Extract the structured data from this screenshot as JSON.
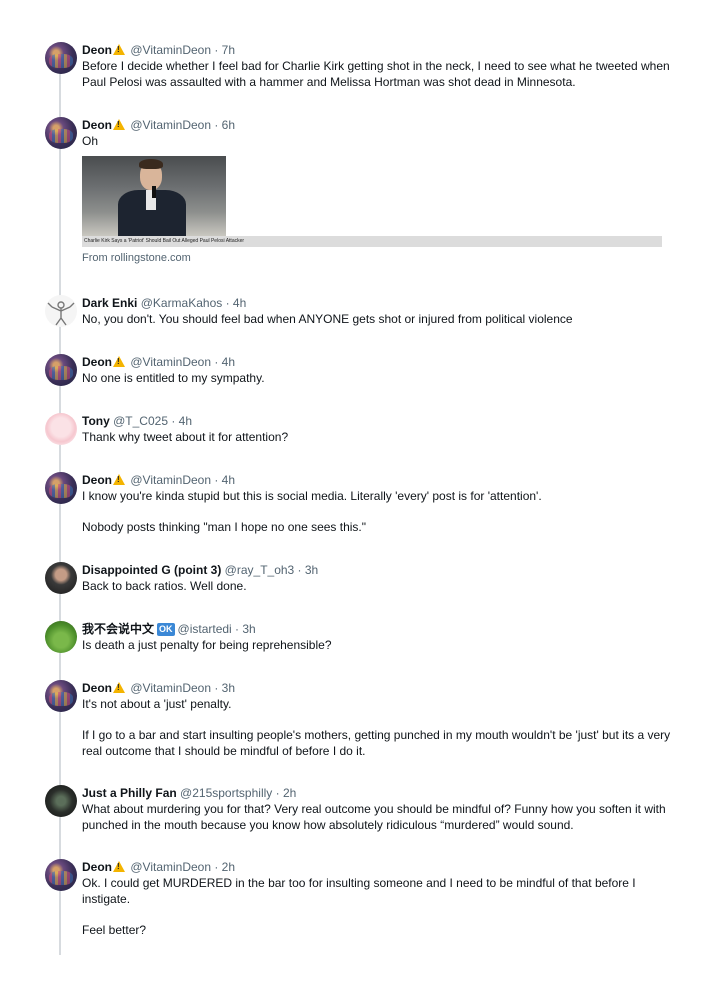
{
  "tweets": [
    {
      "avatar": "deon",
      "name": "Deon",
      "warn": true,
      "handle": "@VitaminDeon · 7h",
      "paragraphs": [
        "Before I decide whether I feel bad for Charlie Kirk getting shot in the neck, I need to see what he tweeted when Paul Pelosi was assaulted with a hammer and Melissa Hortman was shot dead in Minnesota."
      ]
    },
    {
      "avatar": "deon",
      "name": "Deon",
      "warn": true,
      "handle": "@VitaminDeon · 6h",
      "paragraphs": [
        "Oh"
      ],
      "card": {
        "caption": "Charlie Kirk Says a 'Patriot' Should Bail Out Alleged Paul Pelosi Attacker",
        "source": "From rollingstone.com"
      }
    },
    {
      "avatar": "enki",
      "name": "Dark Enki",
      "handle": "@KarmaKahos · 4h",
      "paragraphs": [
        "No, you don't. You should feel bad when ANYONE gets shot or injured from political violence"
      ]
    },
    {
      "avatar": "deon",
      "name": "Deon",
      "warn": true,
      "handle": "@VitaminDeon · 4h",
      "paragraphs": [
        "No one is entitled to my sympathy."
      ]
    },
    {
      "avatar": "tony",
      "name": "Tony",
      "handle": "@T_C025 · 4h",
      "paragraphs": [
        "Thank why tweet about it for attention?"
      ]
    },
    {
      "avatar": "deon",
      "name": "Deon",
      "warn": true,
      "handle": "@VitaminDeon · 4h",
      "paragraphs": [
        "I know you're kinda stupid but this is social media. Literally 'every' post is for 'attention'.",
        "Nobody posts thinking \"man I hope no one sees this.\""
      ]
    },
    {
      "avatar": "dg",
      "name": "Disappointed G (point 3)",
      "handle": "@ray_T_oh3 · 3h",
      "paragraphs": [
        "Back to back ratios. Well done."
      ]
    },
    {
      "avatar": "cn",
      "name": "我不会说中文",
      "badge": "OK",
      "handle": "@istartedi · 3h",
      "paragraphs": [
        "Is death a just penalty for being reprehensible?"
      ]
    },
    {
      "avatar": "deon",
      "name": "Deon",
      "warn": true,
      "handle": "@VitaminDeon · 3h",
      "paragraphs": [
        "It's not about a 'just' penalty.",
        "If I go to a bar and start insulting people's mothers, getting punched in my mouth wouldn't be 'just' but its a very real outcome that I should be mindful of before I do it."
      ]
    },
    {
      "avatar": "philly",
      "name": "Just a Philly Fan",
      "handle": "@215sportsphilly · 2h",
      "paragraphs": [
        "What about murdering you for that? Very real outcome you should be mindful of? Funny how you soften it with punched in the mouth because you know how absolutely ridiculous “murdered” would sound."
      ]
    },
    {
      "avatar": "deon",
      "name": "Deon",
      "warn": true,
      "handle": "@VitaminDeon · 2h",
      "paragraphs": [
        "Ok. I could get MURDERED in the bar too for insulting someone and I need to be mindful of that before I instigate.",
        "Feel better?"
      ]
    }
  ]
}
